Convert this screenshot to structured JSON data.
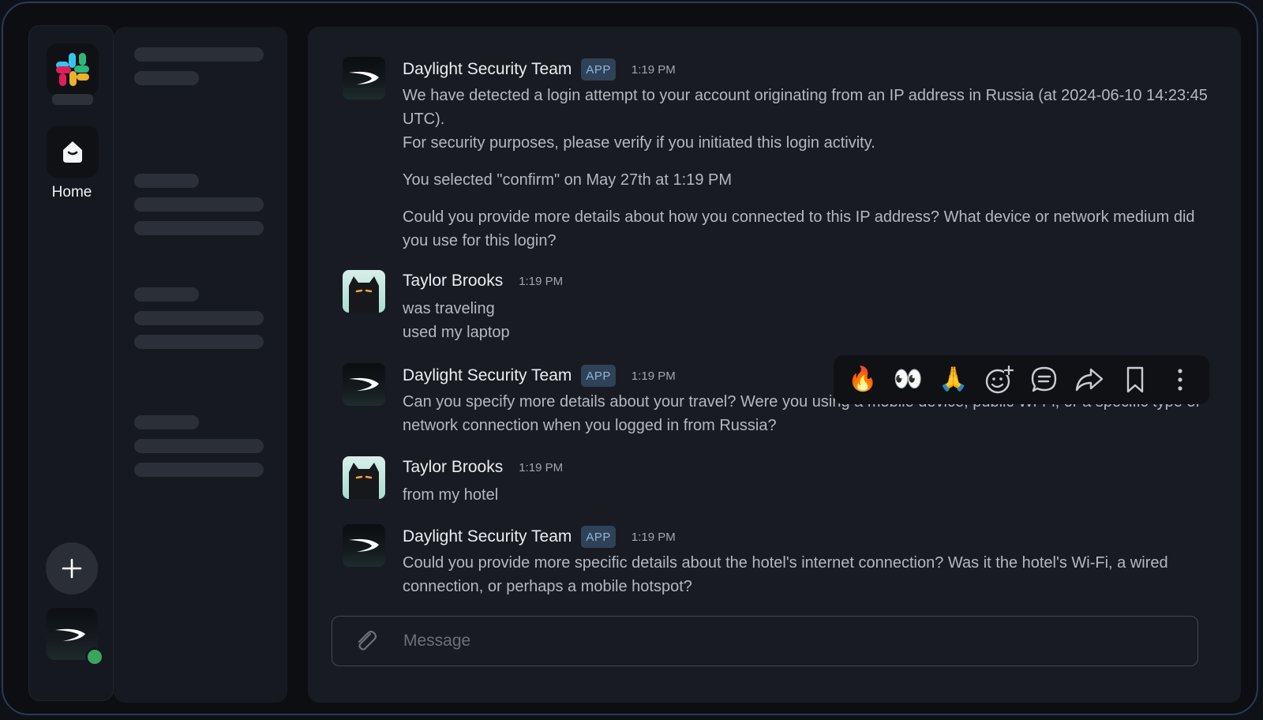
{
  "rail": {
    "home_label": "Home"
  },
  "messages": [
    {
      "author": "Daylight Security Team",
      "badge": "APP",
      "time": "1:19 PM",
      "avatar": "daylight-logo",
      "lines": [
        "We have detected a login attempt to your account originating from an IP address in Russia (at 2024-06-10 14:23:45 UTC).",
        "For security purposes, please verify if you initiated this login activity."
      ],
      "confirmation": "You selected \"confirm\" on May 27th at 1:19 PM",
      "followup": "Could you provide more details about how you connected to this IP address? What device or network medium did you use for this login?"
    },
    {
      "author": "Taylor Brooks",
      "time": "1:19 PM",
      "avatar": "black-cat",
      "lines": [
        "was traveling",
        "used my laptop"
      ]
    },
    {
      "author": "Daylight Security Team",
      "badge": "APP",
      "time": "1:19 PM",
      "avatar": "daylight-logo",
      "lines": [
        "Can you specify more details about your travel? Were you using a mobile device, public Wi-Fi, or a specific type of network connection when you logged in from Russia?"
      ]
    },
    {
      "author": "Taylor Brooks",
      "time": "1:19 PM",
      "avatar": "black-cat",
      "lines": [
        "from my hotel"
      ]
    },
    {
      "author": "Daylight Security Team",
      "badge": "APP",
      "time": "1:19 PM",
      "avatar": "daylight-logo",
      "lines": [
        "Could you provide more specific details about the hotel's internet connection? Was it the hotel's Wi-Fi, a wired connection, or perhaps a mobile hotspot?"
      ]
    }
  ],
  "hover_actions": {
    "reactions": [
      "🔥",
      "👀",
      "🙏"
    ],
    "icons": [
      "add-reaction-icon",
      "reply-in-thread-icon",
      "share-icon",
      "bookmark-icon",
      "more-actions-icon"
    ]
  },
  "composer": {
    "placeholder": "Message"
  },
  "colors": {
    "background": "#181b21",
    "app_badge": "#2f4257",
    "presence_online": "#3aa55d"
  }
}
